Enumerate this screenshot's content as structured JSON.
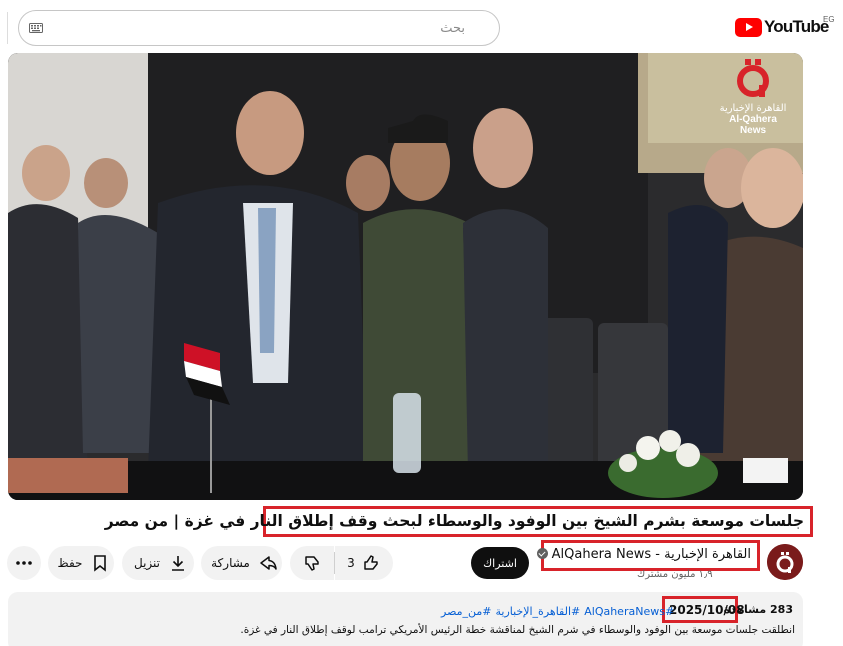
{
  "header": {
    "search_placeholder": "بحث",
    "logo_text": "YouTube",
    "country_code": "EG"
  },
  "video": {
    "watermark_arabic": "القاهرة الإخبارية",
    "watermark_english": "Al-Qahera News",
    "title": "جلسات موسعة بشرم الشيخ بين الوفود والوسطاء لبحث وقف إطلاق النار في غزة | من مصر"
  },
  "channel": {
    "name": "القاهرة الإخبارية - AlQahera News",
    "subscribers": "١٫٩ مليون مشترك",
    "subscribe_label": "اشتراك"
  },
  "actions": {
    "like_count": "3",
    "share_label": "مشاركة",
    "download_label": "تنزيل",
    "save_label": "حفظ"
  },
  "description": {
    "views": "283 مشاهدة",
    "date": "2025/10/08",
    "hashtags": [
      "#AlQaheraNews",
      "#القاهرة_الإخبارية",
      "#من_مصر"
    ],
    "text": "انطلقت جلسات موسعة بين الوفود والوسطاء في شرم الشيخ لمناقشة خطة الرئيس الأمريكي ترامب لوقف إطلاق النار في غزة."
  },
  "colors": {
    "highlight": "#d8232a",
    "brand_red": "#ff0000",
    "link": "#065fd4"
  }
}
